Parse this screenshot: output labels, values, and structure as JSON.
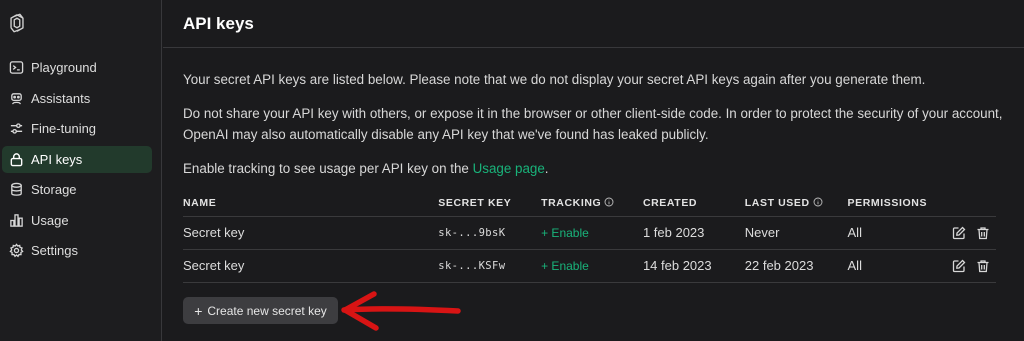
{
  "sidebar": {
    "logo_icon": "openai-logo-icon",
    "items": [
      {
        "label": "Playground",
        "icon": "terminal-icon",
        "active": false
      },
      {
        "label": "Assistants",
        "icon": "robot-icon",
        "active": false
      },
      {
        "label": "Fine-tuning",
        "icon": "sliders-icon",
        "active": false
      },
      {
        "label": "API keys",
        "icon": "lock-icon",
        "active": true
      },
      {
        "label": "Storage",
        "icon": "database-icon",
        "active": false
      },
      {
        "label": "Usage",
        "icon": "bar-chart-icon",
        "active": false
      },
      {
        "label": "Settings",
        "icon": "gear-icon",
        "active": false
      }
    ]
  },
  "header": {
    "title": "API keys"
  },
  "intro": {
    "p1": "Your secret API keys are listed below. Please note that we do not display your secret API keys again after you generate them.",
    "p2": "Do not share your API key with others, or expose it in the browser or other client-side code. In order to protect the security of your account, OpenAI may also automatically disable any API key that we've found has leaked publicly.",
    "p3_before": "Enable tracking to see usage per API key on the ",
    "p3_link": "Usage page",
    "p3_after": "."
  },
  "table": {
    "headers": {
      "name": "NAME",
      "secret_key": "SECRET KEY",
      "tracking": "TRACKING",
      "created": "CREATED",
      "last_used": "LAST USED",
      "permissions": "PERMISSIONS"
    },
    "rows": [
      {
        "name": "Secret key",
        "secret_key": "sk-...9bsK",
        "tracking": "+ Enable",
        "created": "1 feb 2023",
        "last_used": "Never",
        "permissions": "All"
      },
      {
        "name": "Secret key",
        "secret_key": "sk-...KSFw",
        "tracking": "+ Enable",
        "created": "14 feb 2023",
        "last_used": "22 feb 2023",
        "permissions": "All"
      }
    ]
  },
  "create_button": {
    "label": "Create new secret key",
    "icon": "plus-icon"
  },
  "colors": {
    "accent_green": "#19b37a",
    "annotation_arrow": "#d81414",
    "active_nav_bg": "#223a2c"
  }
}
